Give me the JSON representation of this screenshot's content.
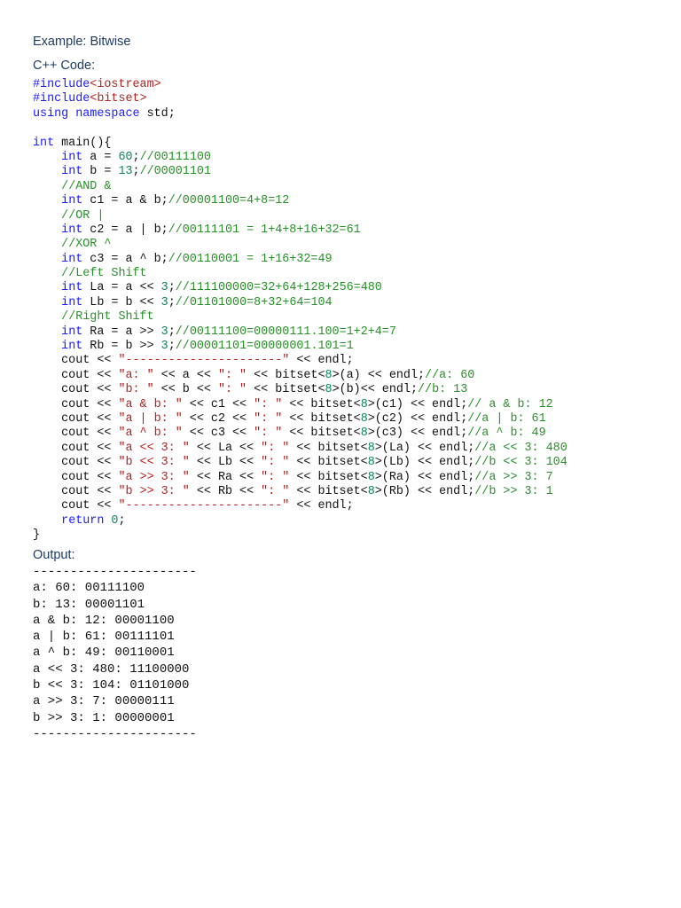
{
  "headings": {
    "title": "Example: Bitwise",
    "code": "C++ Code:",
    "output": "Output:"
  },
  "colors": {
    "keyword": "#1a1aff",
    "string": "#b22222",
    "number": "#098658",
    "comment": "#2a8f2a",
    "heading": "#1f3b63"
  },
  "code_lines": [
    [
      [
        "pp",
        "#include"
      ],
      [
        "str",
        "<iostream>"
      ]
    ],
    [
      [
        "pp",
        "#include"
      ],
      [
        "str",
        "<bitset>"
      ]
    ],
    [
      [
        "kw",
        "using"
      ],
      [
        "plain",
        " "
      ],
      [
        "kw",
        "namespace"
      ],
      [
        "plain",
        " std;"
      ]
    ],
    [],
    [
      [
        "kw",
        "int"
      ],
      [
        "plain",
        " main(){"
      ]
    ],
    [
      [
        "plain",
        "    "
      ],
      [
        "kw",
        "int"
      ],
      [
        "plain",
        " a = "
      ],
      [
        "num",
        "60"
      ],
      [
        "plain",
        ";"
      ],
      [
        "com",
        "//00111100"
      ]
    ],
    [
      [
        "plain",
        "    "
      ],
      [
        "kw",
        "int"
      ],
      [
        "plain",
        " b = "
      ],
      [
        "num",
        "13"
      ],
      [
        "plain",
        ";"
      ],
      [
        "com",
        "//00001101"
      ]
    ],
    [
      [
        "plain",
        "    "
      ],
      [
        "com",
        "//AND &"
      ]
    ],
    [
      [
        "plain",
        "    "
      ],
      [
        "kw",
        "int"
      ],
      [
        "plain",
        " c1 = a & b;"
      ],
      [
        "com",
        "//00001100=4+8=12"
      ]
    ],
    [
      [
        "plain",
        "    "
      ],
      [
        "com",
        "//OR |"
      ]
    ],
    [
      [
        "plain",
        "    "
      ],
      [
        "kw",
        "int"
      ],
      [
        "plain",
        " c2 = a | b;"
      ],
      [
        "com",
        "//00111101 = 1+4+8+16+32=61"
      ]
    ],
    [
      [
        "plain",
        "    "
      ],
      [
        "com",
        "//XOR ^"
      ]
    ],
    [
      [
        "plain",
        "    "
      ],
      [
        "kw",
        "int"
      ],
      [
        "plain",
        " c3 = a ^ b;"
      ],
      [
        "com",
        "//00110001 = 1+16+32=49"
      ]
    ],
    [
      [
        "plain",
        "    "
      ],
      [
        "com",
        "//Left Shift"
      ]
    ],
    [
      [
        "plain",
        "    "
      ],
      [
        "kw",
        "int"
      ],
      [
        "plain",
        " La = a << "
      ],
      [
        "num",
        "3"
      ],
      [
        "plain",
        ";"
      ],
      [
        "com",
        "//111100000=32+64+128+256=480"
      ]
    ],
    [
      [
        "plain",
        "    "
      ],
      [
        "kw",
        "int"
      ],
      [
        "plain",
        " Lb = b << "
      ],
      [
        "num",
        "3"
      ],
      [
        "plain",
        ";"
      ],
      [
        "com",
        "//01101000=8+32+64=104"
      ]
    ],
    [
      [
        "plain",
        "    "
      ],
      [
        "com",
        "//Right Shift"
      ]
    ],
    [
      [
        "plain",
        "    "
      ],
      [
        "kw",
        "int"
      ],
      [
        "plain",
        " Ra = a >> "
      ],
      [
        "num",
        "3"
      ],
      [
        "plain",
        ";"
      ],
      [
        "com",
        "//00111100=00000111.100=1+2+4=7"
      ]
    ],
    [
      [
        "plain",
        "    "
      ],
      [
        "kw",
        "int"
      ],
      [
        "plain",
        " Rb = b >> "
      ],
      [
        "num",
        "3"
      ],
      [
        "plain",
        ";"
      ],
      [
        "com",
        "//00001101=00000001.101=1"
      ]
    ],
    [
      [
        "plain",
        "    cout << "
      ],
      [
        "str",
        "\"----------------------\""
      ],
      [
        "plain",
        " << endl;"
      ]
    ],
    [
      [
        "plain",
        "    cout << "
      ],
      [
        "str",
        "\"a: \""
      ],
      [
        "plain",
        " << a << "
      ],
      [
        "str",
        "\": \""
      ],
      [
        "plain",
        " << bitset<"
      ],
      [
        "num",
        "8"
      ],
      [
        "plain",
        ">(a) << endl;"
      ],
      [
        "com",
        "//a: 60"
      ]
    ],
    [
      [
        "plain",
        "    cout << "
      ],
      [
        "str",
        "\"b: \""
      ],
      [
        "plain",
        " << b << "
      ],
      [
        "str",
        "\": \""
      ],
      [
        "plain",
        " << bitset<"
      ],
      [
        "num",
        "8"
      ],
      [
        "plain",
        ">(b)<< endl;"
      ],
      [
        "com",
        "//b: 13"
      ]
    ],
    [
      [
        "plain",
        "    cout << "
      ],
      [
        "str",
        "\"a & b: \""
      ],
      [
        "plain",
        " << c1 << "
      ],
      [
        "str",
        "\": \""
      ],
      [
        "plain",
        " << bitset<"
      ],
      [
        "num",
        "8"
      ],
      [
        "plain",
        ">(c1) << endl;"
      ],
      [
        "com",
        "// a & b: 12"
      ]
    ],
    [
      [
        "plain",
        "    cout << "
      ],
      [
        "str",
        "\"a | b: \""
      ],
      [
        "plain",
        " << c2 << "
      ],
      [
        "str",
        "\": \""
      ],
      [
        "plain",
        " << bitset<"
      ],
      [
        "num",
        "8"
      ],
      [
        "plain",
        ">(c2) << endl;"
      ],
      [
        "com",
        "//a | b: 61"
      ]
    ],
    [
      [
        "plain",
        "    cout << "
      ],
      [
        "str",
        "\"a ^ b: \""
      ],
      [
        "plain",
        " << c3 << "
      ],
      [
        "str",
        "\": \""
      ],
      [
        "plain",
        " << bitset<"
      ],
      [
        "num",
        "8"
      ],
      [
        "plain",
        ">(c3) << endl;"
      ],
      [
        "com",
        "//a ^ b: 49"
      ]
    ],
    [
      [
        "plain",
        "    cout << "
      ],
      [
        "str",
        "\"a << 3: \""
      ],
      [
        "plain",
        " << La << "
      ],
      [
        "str",
        "\": \""
      ],
      [
        "plain",
        " << bitset<"
      ],
      [
        "num",
        "8"
      ],
      [
        "plain",
        ">(La) << endl;"
      ],
      [
        "com",
        "//a << 3: 480"
      ]
    ],
    [
      [
        "plain",
        "    cout << "
      ],
      [
        "str",
        "\"b << 3: \""
      ],
      [
        "plain",
        " << Lb << "
      ],
      [
        "str",
        "\": \""
      ],
      [
        "plain",
        " << bitset<"
      ],
      [
        "num",
        "8"
      ],
      [
        "plain",
        ">(Lb) << endl;"
      ],
      [
        "com",
        "//b << 3: 104"
      ]
    ],
    [
      [
        "plain",
        "    cout << "
      ],
      [
        "str",
        "\"a >> 3: \""
      ],
      [
        "plain",
        " << Ra << "
      ],
      [
        "str",
        "\": \""
      ],
      [
        "plain",
        " << bitset<"
      ],
      [
        "num",
        "8"
      ],
      [
        "plain",
        ">(Ra) << endl;"
      ],
      [
        "com",
        "//a >> 3: 7"
      ]
    ],
    [
      [
        "plain",
        "    cout << "
      ],
      [
        "str",
        "\"b >> 3: \""
      ],
      [
        "plain",
        " << Rb << "
      ],
      [
        "str",
        "\": \""
      ],
      [
        "plain",
        " << bitset<"
      ],
      [
        "num",
        "8"
      ],
      [
        "plain",
        ">(Rb) << endl;"
      ],
      [
        "com",
        "//b >> 3: 1"
      ]
    ],
    [
      [
        "plain",
        "    cout << "
      ],
      [
        "str",
        "\"----------------------\""
      ],
      [
        "plain",
        " << endl;"
      ]
    ],
    [
      [
        "plain",
        "    "
      ],
      [
        "kw",
        "return"
      ],
      [
        "plain",
        " "
      ],
      [
        "num",
        "0"
      ],
      [
        "plain",
        ";"
      ]
    ],
    [
      [
        "plain",
        "}"
      ]
    ]
  ],
  "output_lines": [
    "----------------------",
    "a: 60: 00111100",
    "b: 13: 00001101",
    "a & b: 12: 00001100",
    "a | b: 61: 00111101",
    "a ^ b: 49: 00110001",
    "a << 3: 480: 11100000",
    "b << 3: 104: 01101000",
    "a >> 3: 7: 00000111",
    "b >> 3: 1: 00000001",
    "----------------------"
  ]
}
